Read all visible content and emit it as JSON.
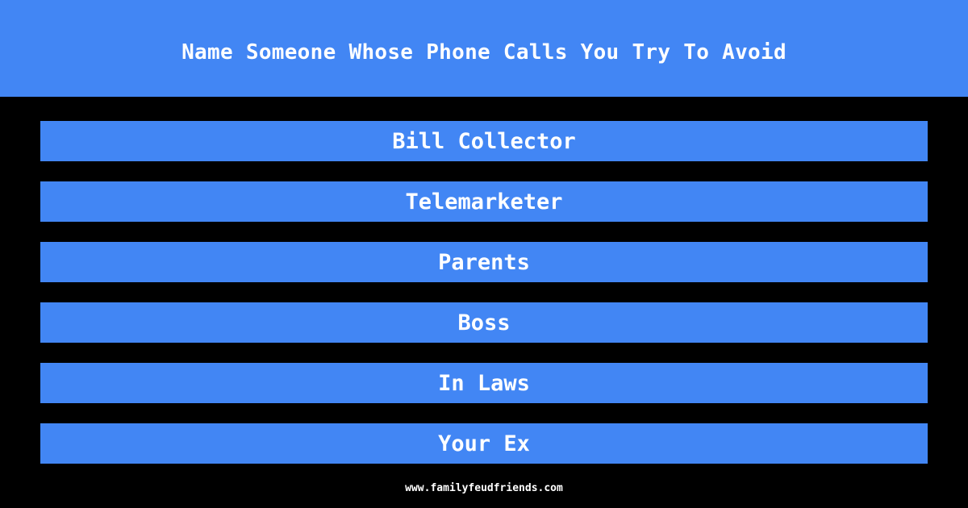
{
  "question": "Name Someone Whose Phone Calls You Try To Avoid",
  "answers": [
    {
      "label": "Bill Collector"
    },
    {
      "label": "Telemarketer"
    },
    {
      "label": "Parents"
    },
    {
      "label": "Boss"
    },
    {
      "label": "In Laws"
    },
    {
      "label": "Your Ex"
    }
  ],
  "footer": "www.familyfeudfriends.com",
  "colors": {
    "accent": "#4286f4",
    "background": "#000000",
    "text": "#ffffff"
  }
}
